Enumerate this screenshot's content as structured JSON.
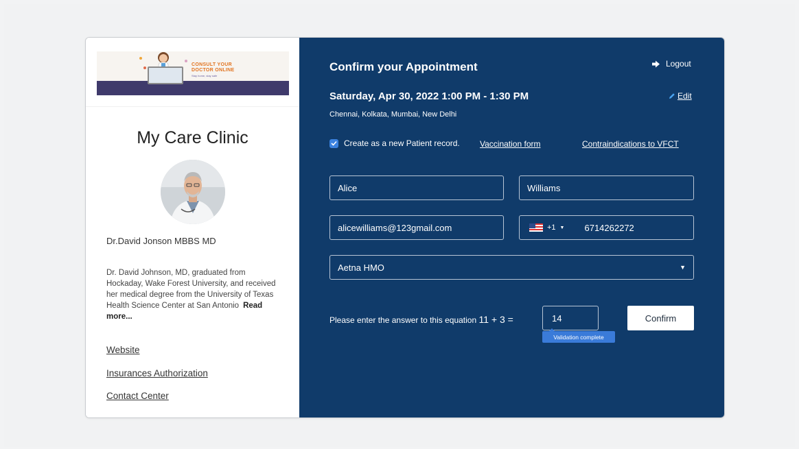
{
  "banner": {
    "line1": "CONSULT YOUR",
    "line2": "DOCTOR ONLINE",
    "line3": "Stay home, stay safe"
  },
  "clinic": {
    "name": "My Care Clinic",
    "doctor_name": "Dr.David Jonson MBBS MD",
    "bio": "Dr. David Johnson, MD, graduated from Hockaday, Wake Forest University, and received her medical degree from the University of Texas Health Science Center at San Antonio",
    "read_more": "Read more..."
  },
  "links": {
    "website": "Website",
    "insurance": "Insurances Authorization",
    "contact": "Contact Center"
  },
  "appointment": {
    "title": "Confirm your Appointment",
    "logout": "Logout",
    "date": "Saturday, Apr 30, 2022 1:00 PM - 1:30 PM",
    "edit": "Edit",
    "cities": "Chennai, Kolkata, Mumbai, New Delhi",
    "checkbox_label": "Create as a new Patient record.",
    "checkbox_checked": true,
    "vaccination_link": "Vaccination form",
    "contra_link": "Contraindications to VFCT"
  },
  "form": {
    "first_name": "Alice",
    "last_name": "Williams",
    "email": "alicewilliams@123gmail.com",
    "country_code": "+1",
    "phone": "6714262272",
    "insurance": "Aetna HMO",
    "equation_label": "Please enter the answer to this equation",
    "equation": "11 + 3 =",
    "answer": "14",
    "validation": "Validation complete",
    "confirm": "Confirm"
  },
  "colors": {
    "panel": "#103b6a",
    "accent": "#3a7bd9"
  }
}
